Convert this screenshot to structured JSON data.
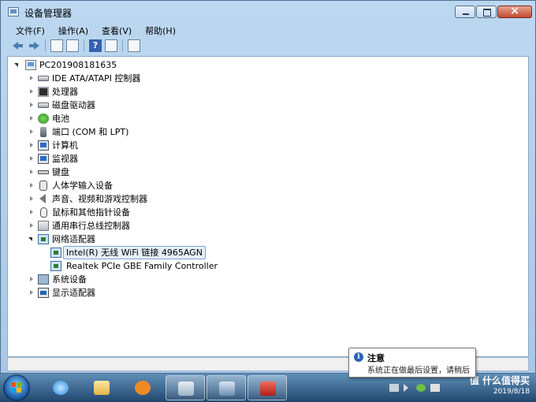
{
  "window": {
    "title": "设备管理器"
  },
  "menu": [
    "文件(F)",
    "操作(A)",
    "查看(V)",
    "帮助(H)"
  ],
  "tree": {
    "root": "PC201908181635",
    "categories": [
      {
        "label": "IDE ATA/ATAPI 控制器",
        "icon": "disk-controller-icon"
      },
      {
        "label": "处理器",
        "icon": "processor-icon"
      },
      {
        "label": "磁盘驱动器",
        "icon": "disk-drive-icon"
      },
      {
        "label": "电池",
        "icon": "battery-icon"
      },
      {
        "label": "端口 (COM 和 LPT)",
        "icon": "port-icon"
      },
      {
        "label": "计算机",
        "icon": "computer-icon"
      },
      {
        "label": "监视器",
        "icon": "monitor-icon"
      },
      {
        "label": "键盘",
        "icon": "keyboard-icon"
      },
      {
        "label": "人体学输入设备",
        "icon": "hid-icon"
      },
      {
        "label": "声音、视频和游戏控制器",
        "icon": "sound-icon"
      },
      {
        "label": "鼠标和其他指针设备",
        "icon": "mouse-icon"
      },
      {
        "label": "通用串行总线控制器",
        "icon": "usb-icon"
      },
      {
        "label": "网络适配器",
        "icon": "network-adapter-icon",
        "expanded": true,
        "children": [
          "Intel(R) 无线 WiFi 链接 4965AGN",
          "Realtek PCIe GBE Family Controller"
        ]
      },
      {
        "label": "系统设备",
        "icon": "system-device-icon"
      },
      {
        "label": "显示适配器",
        "icon": "display-adapter-icon"
      }
    ]
  },
  "notification": {
    "title": "注意",
    "body": "系统正在做最后设置，请稍后"
  },
  "taskbar": {
    "clock_date": "2019/8/18",
    "watermark": "值 什么值得买"
  },
  "colors": {
    "selection_border": "#7da2ce",
    "taskbar": "#21476e",
    "window_frame": "#bcd8f0"
  }
}
